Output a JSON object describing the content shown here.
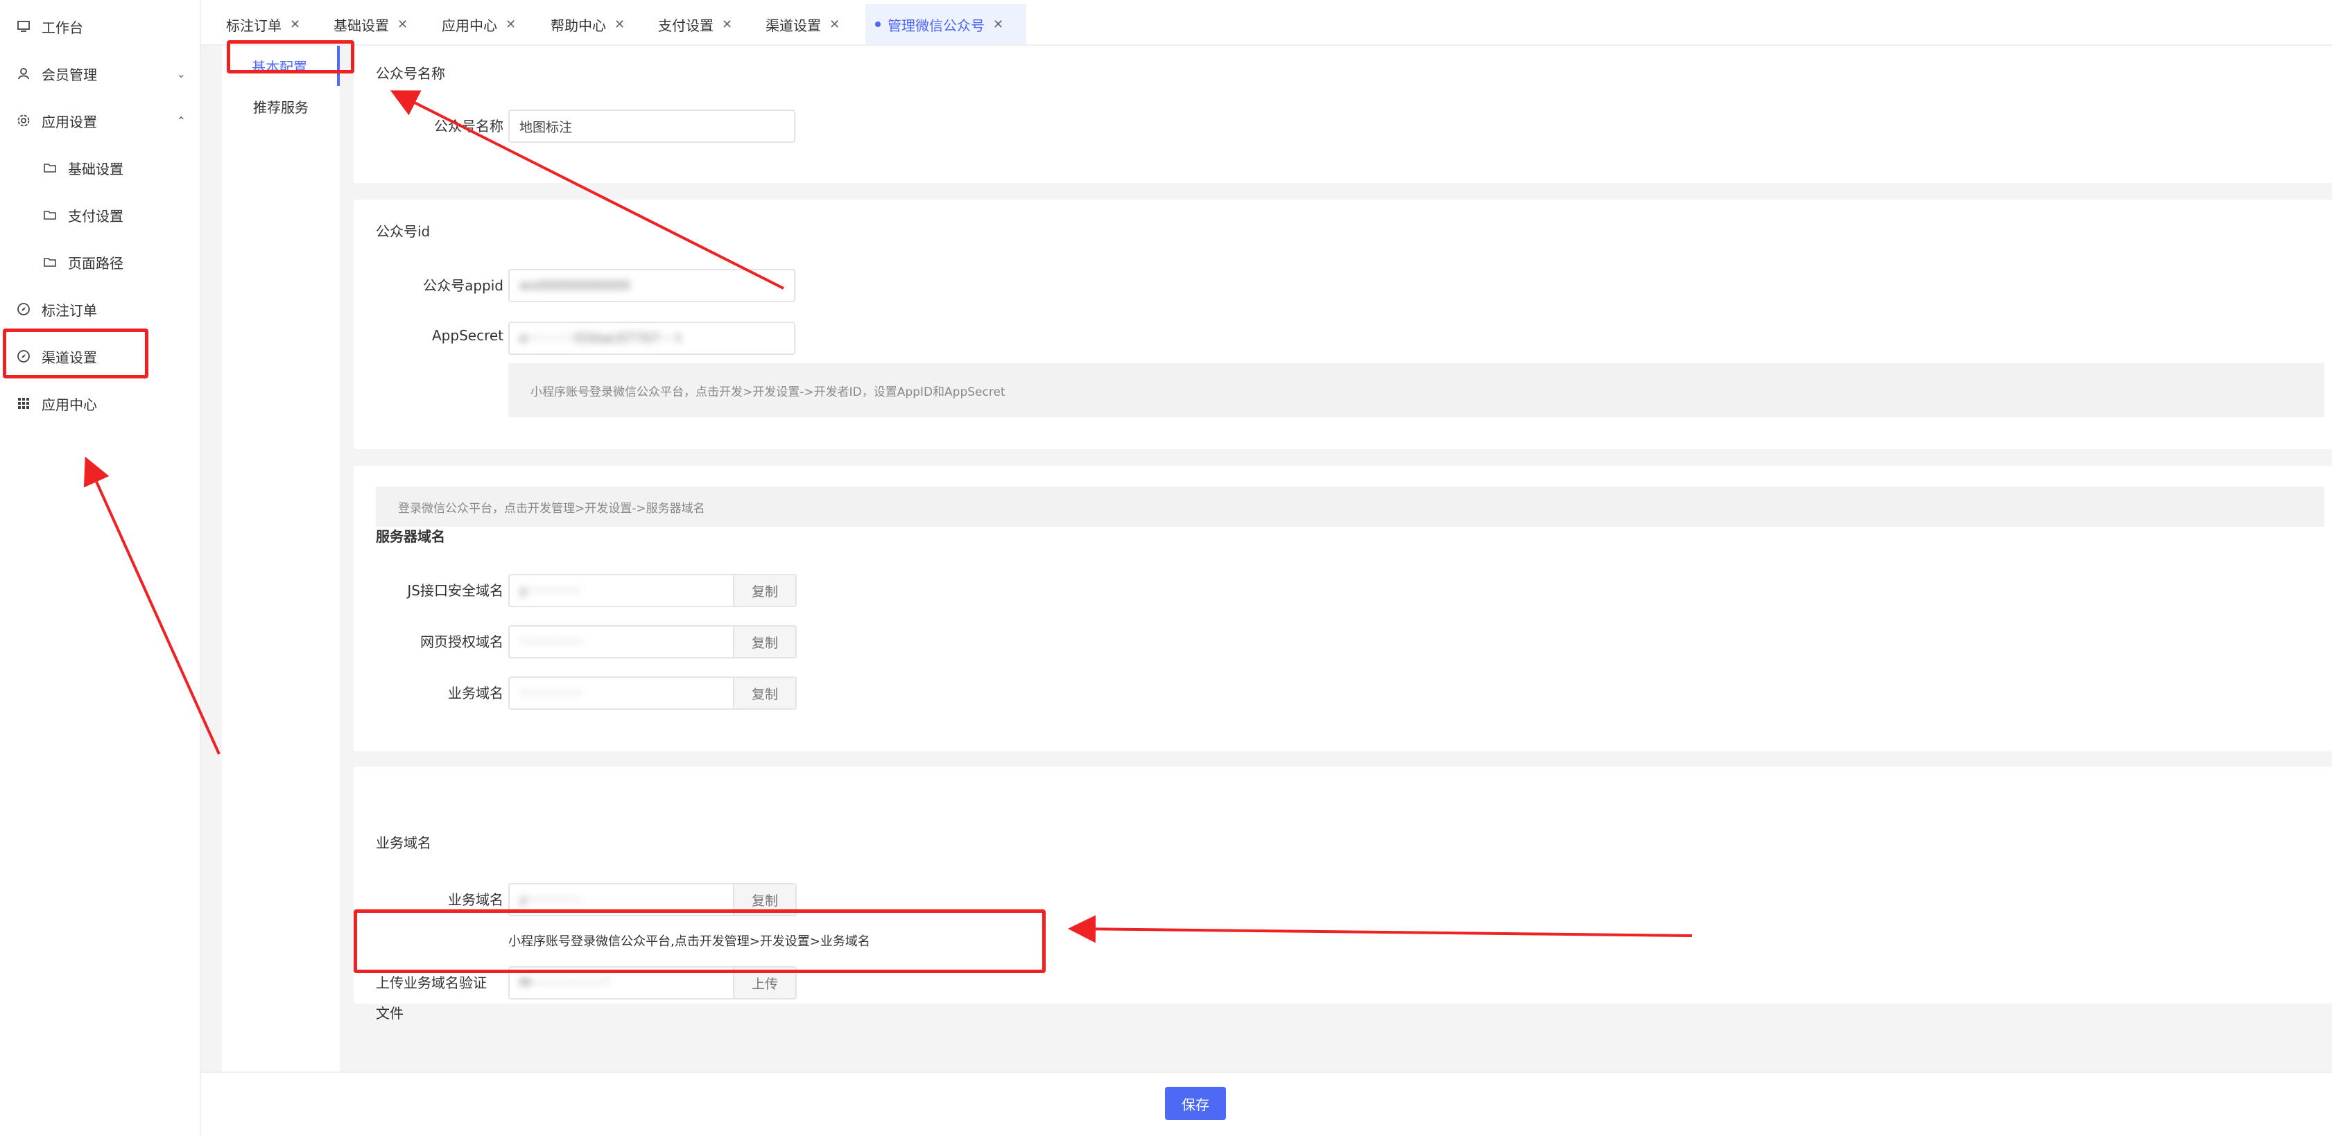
{
  "sidebar": {
    "items": [
      {
        "label": "工作台",
        "icon": "monitor-icon"
      },
      {
        "label": "会员管理",
        "icon": "user-icon",
        "caret": "⌄"
      },
      {
        "label": "应用设置",
        "icon": "gear-icon",
        "caret": "⌃"
      },
      {
        "label": "基础设置",
        "icon": "folder-icon"
      },
      {
        "label": "支付设置",
        "icon": "folder-icon"
      },
      {
        "label": "页面路径",
        "icon": "folder-icon"
      },
      {
        "label": "标注订单",
        "icon": "compass-icon"
      },
      {
        "label": "渠道设置",
        "icon": "compass-icon"
      },
      {
        "label": "应用中心",
        "icon": "grid-icon"
      }
    ]
  },
  "tabs": [
    {
      "label": "标注订单"
    },
    {
      "label": "基础设置"
    },
    {
      "label": "应用中心"
    },
    {
      "label": "帮助中心"
    },
    {
      "label": "支付设置"
    },
    {
      "label": "渠道设置"
    },
    {
      "label": "管理微信公众号",
      "active": true
    }
  ],
  "tab_close": "✕",
  "subnav": {
    "items": [
      {
        "label": "基本配置",
        "active": true
      },
      {
        "label": "推荐服务"
      }
    ]
  },
  "card1": {
    "title": "公众号名称",
    "name_label": "公众号名称",
    "name_value": "地图标注"
  },
  "card2": {
    "title": "公众号id",
    "appid_label": "公众号appid",
    "appid_value": "wx00000000000",
    "secret_label": "AppSecret",
    "secret_value": "e···········i55bac07707····t",
    "hint": "小程序账号登录微信公众平台，点击开发>开发设置->开发者ID，设置AppID和AppSecret"
  },
  "card3": {
    "hint": "登录微信公众平台，点击开发管理>开发设置->服务器域名",
    "title": "服务器域名",
    "rows": [
      {
        "label": "JS接口安全域名",
        "value": "y·············",
        "btn": "复制"
      },
      {
        "label": "网页授权域名",
        "value": "···············",
        "btn": "复制"
      },
      {
        "label": "业务域名",
        "value": "···············",
        "btn": "复制"
      }
    ]
  },
  "card4": {
    "title": "业务域名",
    "domain_label": "业务域名",
    "domain_value": "y·············",
    "domain_btn": "复制",
    "hint": "小程序账号登录微信公众平台,点击开发管理>开发设置>业务域名",
    "upload_label_1": "上传业务域名验证",
    "upload_label_2": "文件",
    "upload_value": "M··················'",
    "upload_btn": "上传"
  },
  "footer": {
    "save_label": "保存"
  },
  "colors": {
    "accent": "#4e6af5",
    "annotation": "#ee2222"
  }
}
